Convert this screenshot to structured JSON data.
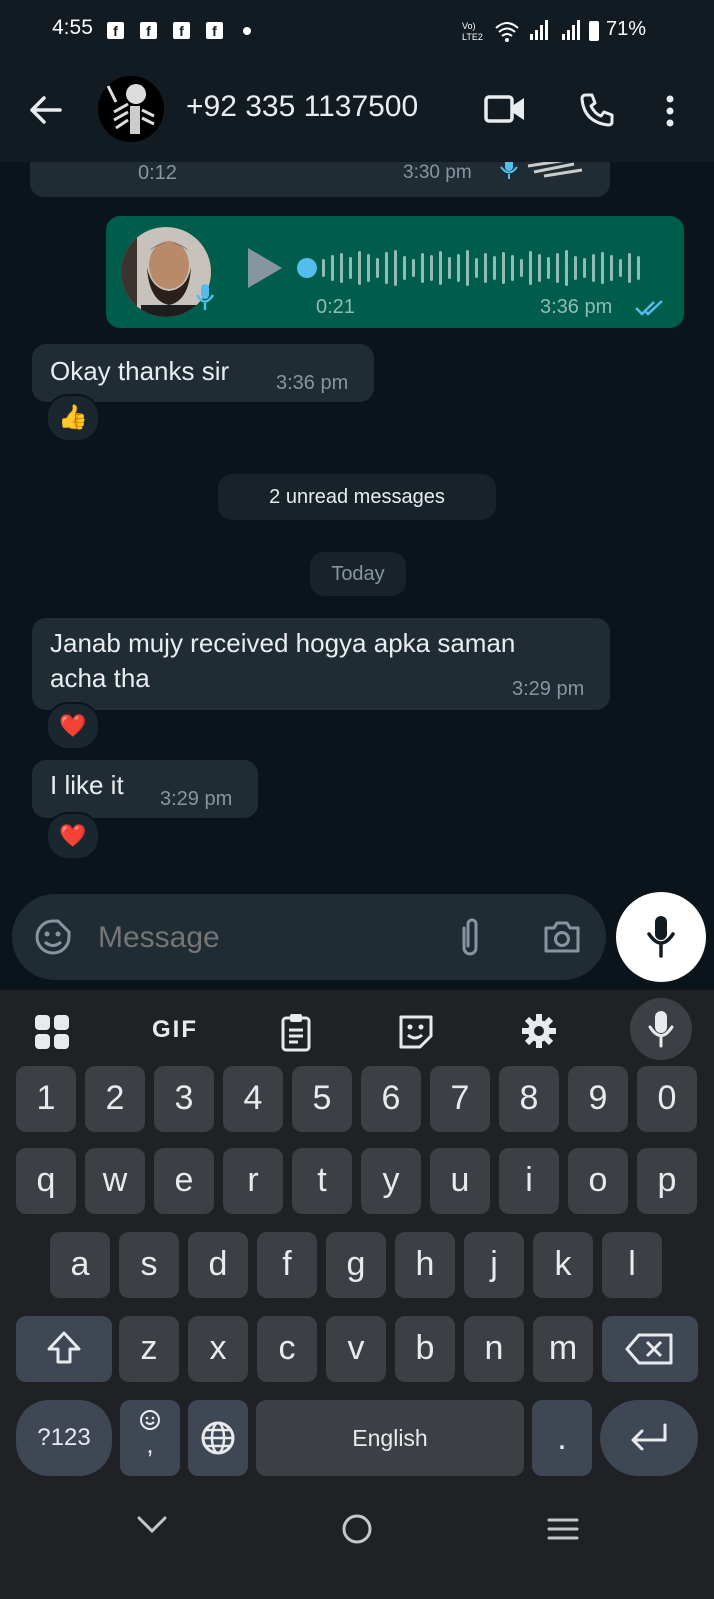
{
  "status_bar": {
    "time": "4:55",
    "fb_icons": [
      "f",
      "f",
      "f",
      "f"
    ],
    "battery": "71%"
  },
  "header": {
    "contact_name": "+92 335 1137500"
  },
  "messages": {
    "prev_voice_duration": "0:12",
    "prev_voice_time": "3:30 pm",
    "voice_duration": "0:21",
    "voice_time": "3:36 pm",
    "okay_text": "Okay thanks sir",
    "okay_time": "3:36 pm",
    "okay_reaction": "👍",
    "unread": "2 unread messages",
    "date_divider": "Today",
    "janab_line1": "Janab mujy received hogya apka saman",
    "janab_line2": "acha tha",
    "janab_time": "3:29 pm",
    "janab_reaction": "❤️",
    "like_text": "I like it",
    "like_time": "3:29 pm",
    "like_reaction": "❤️"
  },
  "input": {
    "placeholder": "Message"
  },
  "keyboard": {
    "toolbar": {
      "gif": "GIF"
    },
    "row_numbers": [
      "1",
      "2",
      "3",
      "4",
      "5",
      "6",
      "7",
      "8",
      "9",
      "0"
    ],
    "row1": [
      "q",
      "w",
      "e",
      "r",
      "t",
      "y",
      "u",
      "i",
      "o",
      "p"
    ],
    "row2": [
      "a",
      "s",
      "d",
      "f",
      "g",
      "h",
      "j",
      "k",
      "l"
    ],
    "row3": [
      "z",
      "x",
      "c",
      "v",
      "b",
      "n",
      "m"
    ],
    "symbols": "?123",
    "comma": ",",
    "space": "English",
    "period": "."
  },
  "colors": {
    "chat_bg": "#0b141a",
    "incoming": "#202c33",
    "outgoing": "#005c4b",
    "accent": "#53bdeb"
  }
}
